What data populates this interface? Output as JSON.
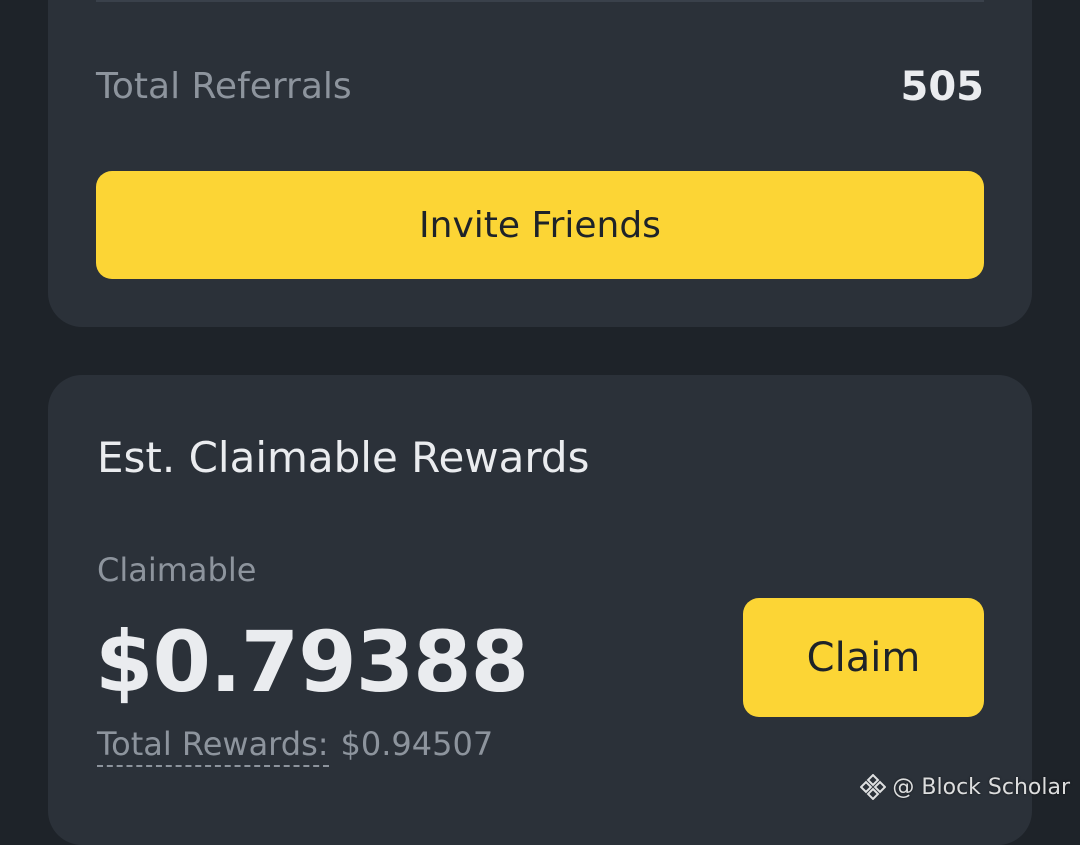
{
  "referrals": {
    "label": "Total Referrals",
    "value": "505",
    "invite_button": "Invite Friends"
  },
  "rewards": {
    "title": "Est. Claimable Rewards",
    "claimable_label": "Claimable",
    "claimable_amount": "$0.79388",
    "claim_button": "Claim",
    "total_label": "Total Rewards:",
    "total_value": "$0.94507"
  },
  "watermark": {
    "text": "@ Block Scholar",
    "icon": "binance-logo-icon"
  },
  "colors": {
    "background": "#1e2329",
    "card": "#2b3139",
    "accent": "#fcd535",
    "text_primary": "#eaecef",
    "text_secondary": "#8d949d"
  }
}
